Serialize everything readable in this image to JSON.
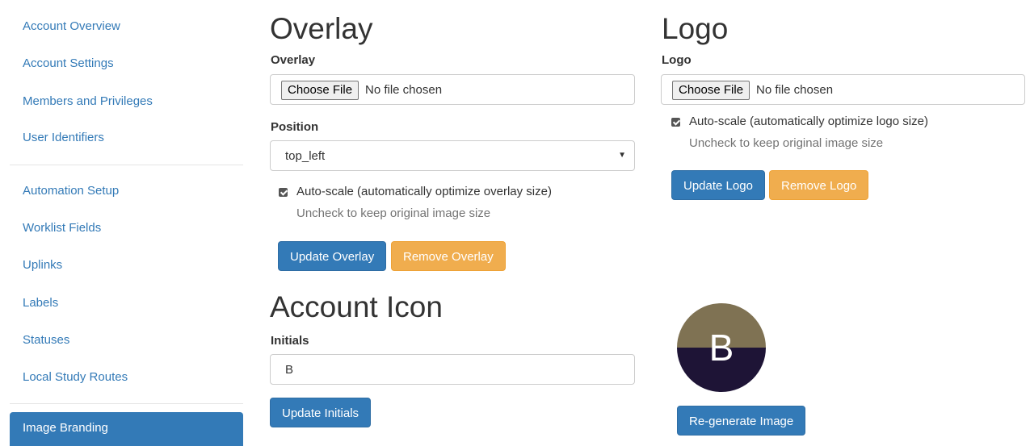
{
  "sidebar": {
    "items": [
      {
        "label": "Account Overview"
      },
      {
        "label": "Account Settings"
      },
      {
        "label": "Members and Privileges"
      },
      {
        "label": "User Identifiers"
      },
      {
        "label": "Automation Setup"
      },
      {
        "label": "Worklist Fields"
      },
      {
        "label": "Uplinks"
      },
      {
        "label": "Labels"
      },
      {
        "label": "Statuses"
      },
      {
        "label": "Local Study Routes"
      },
      {
        "label": "Image Branding"
      }
    ],
    "active_label": "Image Branding"
  },
  "overlay": {
    "heading": "Overlay",
    "file_label": "Overlay",
    "file_button": "Choose File",
    "file_status": "No file chosen",
    "position_label": "Position",
    "position_value": "top_left",
    "autoscale_label": "Auto-scale (automatically optimize overlay size)",
    "autoscale_help": "Uncheck to keep original image size",
    "update_button": "Update Overlay",
    "remove_button": "Remove Overlay"
  },
  "logo": {
    "heading": "Logo",
    "file_label": "Logo",
    "file_button": "Choose File",
    "file_status": "No file chosen",
    "autoscale_label": "Auto-scale (automatically optimize logo size)",
    "autoscale_help": "Uncheck to keep original image size",
    "update_button": "Update Logo",
    "remove_button": "Remove Logo"
  },
  "account_icon": {
    "heading": "Account Icon",
    "initials_label": "Initials",
    "initials_value": "B",
    "update_button": "Update Initials",
    "avatar_letter": "B",
    "avatar_top_color": "#7f7253",
    "avatar_bottom_color": "#1e1436",
    "regenerate_button": "Re-generate Image"
  },
  "colors": {
    "primary": "#337ab7",
    "warning": "#f0ad4e",
    "link": "#337ab7"
  }
}
